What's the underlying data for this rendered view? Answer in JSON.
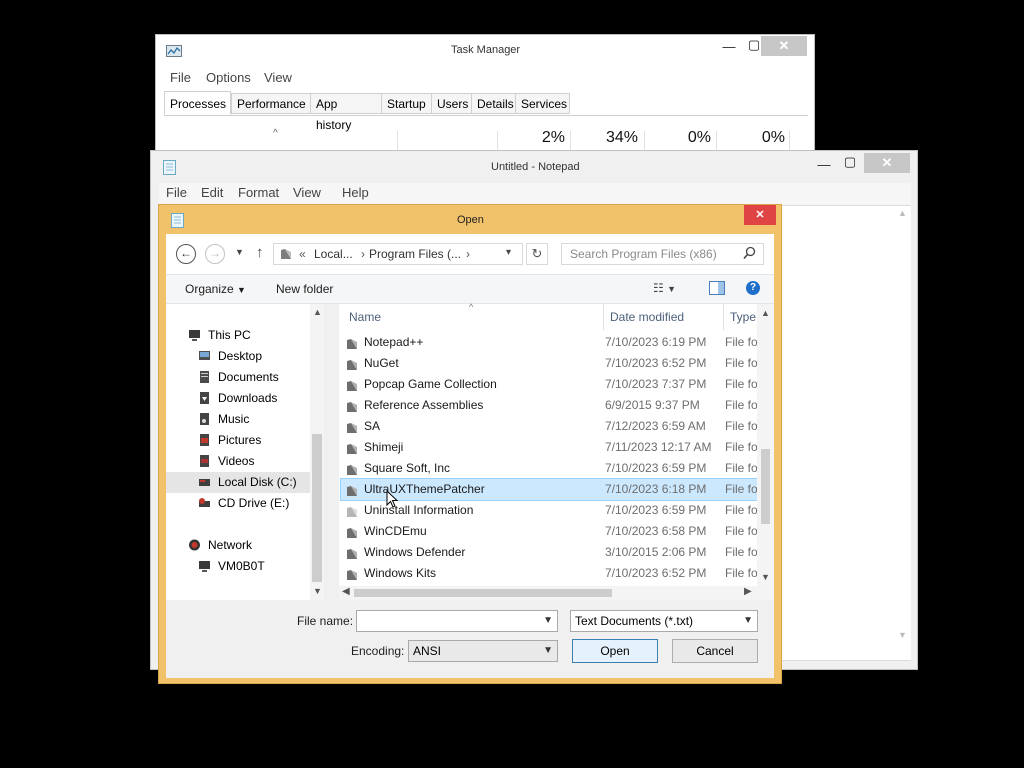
{
  "task_manager": {
    "title": "Task Manager",
    "menu": [
      "File",
      "Options",
      "View"
    ],
    "tabs": [
      "Processes",
      "Performance",
      "App history",
      "Startup",
      "Users",
      "Details",
      "Services"
    ],
    "columns": [
      "2%",
      "34%",
      "0%",
      "0%"
    ],
    "sort_glyph": "^"
  },
  "notepad": {
    "title": "Untitled - Notepad",
    "menu": [
      "File",
      "Edit",
      "Format",
      "View",
      "Help"
    ]
  },
  "open_dialog": {
    "title": "Open",
    "close_glyph": "✕",
    "breadcrumb": {
      "overflow": "«",
      "segments": [
        "Local...",
        "Program Files (..."
      ],
      "sep": "›"
    },
    "search_placeholder": "Search Program Files (x86)",
    "toolbar": {
      "organize": "Organize",
      "new_folder": "New folder"
    },
    "nav": {
      "this_pc": "This PC",
      "items": [
        "Desktop",
        "Documents",
        "Downloads",
        "Music",
        "Pictures",
        "Videos",
        "Local Disk (C:)",
        "CD Drive (E:)"
      ],
      "network": "Network",
      "network_items": [
        "VM0B0T"
      ]
    },
    "columns": {
      "name": "Name",
      "date": "Date modified",
      "type": "Type"
    },
    "files": [
      {
        "name": "Notepad++",
        "date": "7/10/2023 6:19 PM",
        "type": "File folder"
      },
      {
        "name": "NuGet",
        "date": "7/10/2023 6:52 PM",
        "type": "File folder"
      },
      {
        "name": "Popcap Game Collection",
        "date": "7/10/2023 7:37 PM",
        "type": "File folder"
      },
      {
        "name": "Reference Assemblies",
        "date": "6/9/2015 9:37 PM",
        "type": "File folder"
      },
      {
        "name": "SA",
        "date": "7/12/2023 6:59 AM",
        "type": "File folder"
      },
      {
        "name": "Shimeji",
        "date": "7/11/2023 12:17 AM",
        "type": "File folder"
      },
      {
        "name": "Square Soft, Inc",
        "date": "7/10/2023 6:59 PM",
        "type": "File folder"
      },
      {
        "name": "UltraUXThemePatcher",
        "date": "7/10/2023 6:18 PM",
        "type": "File folder"
      },
      {
        "name": "Uninstall Information",
        "date": "7/10/2023 6:59 PM",
        "type": "File folder"
      },
      {
        "name": "WinCDEmu",
        "date": "7/10/2023 6:58 PM",
        "type": "File folder"
      },
      {
        "name": "Windows Defender",
        "date": "3/10/2015 2:06 PM",
        "type": "File folder"
      },
      {
        "name": "Windows Kits",
        "date": "7/10/2023 6:52 PM",
        "type": "File folder"
      }
    ],
    "selected_index": 7,
    "file_name_label": "File name:",
    "file_name_value": "",
    "filter_value": "Text Documents (*.txt)",
    "encoding_label": "Encoding:",
    "encoding_value": "ANSI",
    "open_button": "Open",
    "cancel_button": "Cancel"
  },
  "colors": {
    "dialog_frame": "#f2c26a",
    "close_red": "#e04343",
    "selection": "#cce8ff",
    "selection_border": "#99d1ff",
    "primary_button_border": "#3c7fb1"
  }
}
